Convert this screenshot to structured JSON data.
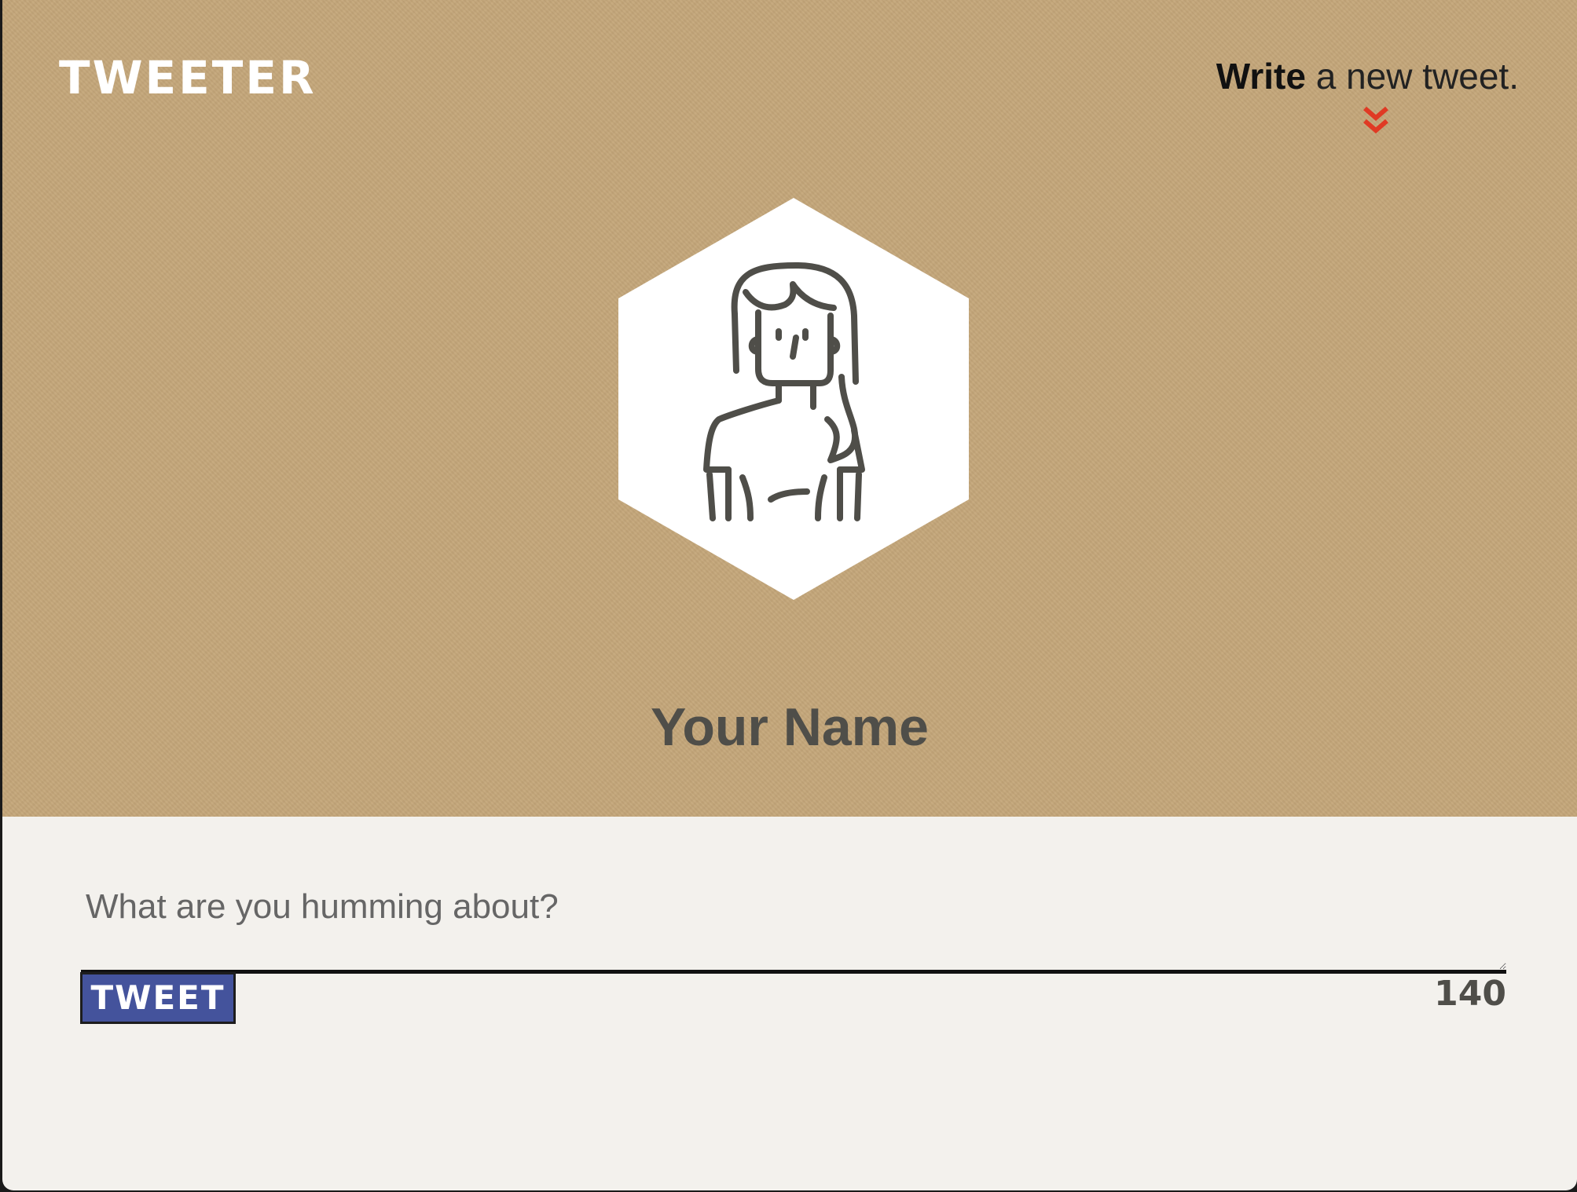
{
  "header": {
    "brand": "TWEETER",
    "hint_bold": "Write",
    "hint_rest": " a new tweet.",
    "chevron_icon": "double-chevron-down-icon",
    "chevron_color": "#e03a24"
  },
  "profile": {
    "avatar_icon": "female-user-avatar-icon",
    "name": "Your Name"
  },
  "composer": {
    "placeholder": "What are you humming about?",
    "value": "",
    "button_label": "TWEET",
    "char_count": "140"
  },
  "colors": {
    "hero_bg": "#c4a679",
    "composer_bg": "#f3f1ed",
    "button_bg": "#44539c",
    "text_dark": "#4f4e49"
  }
}
